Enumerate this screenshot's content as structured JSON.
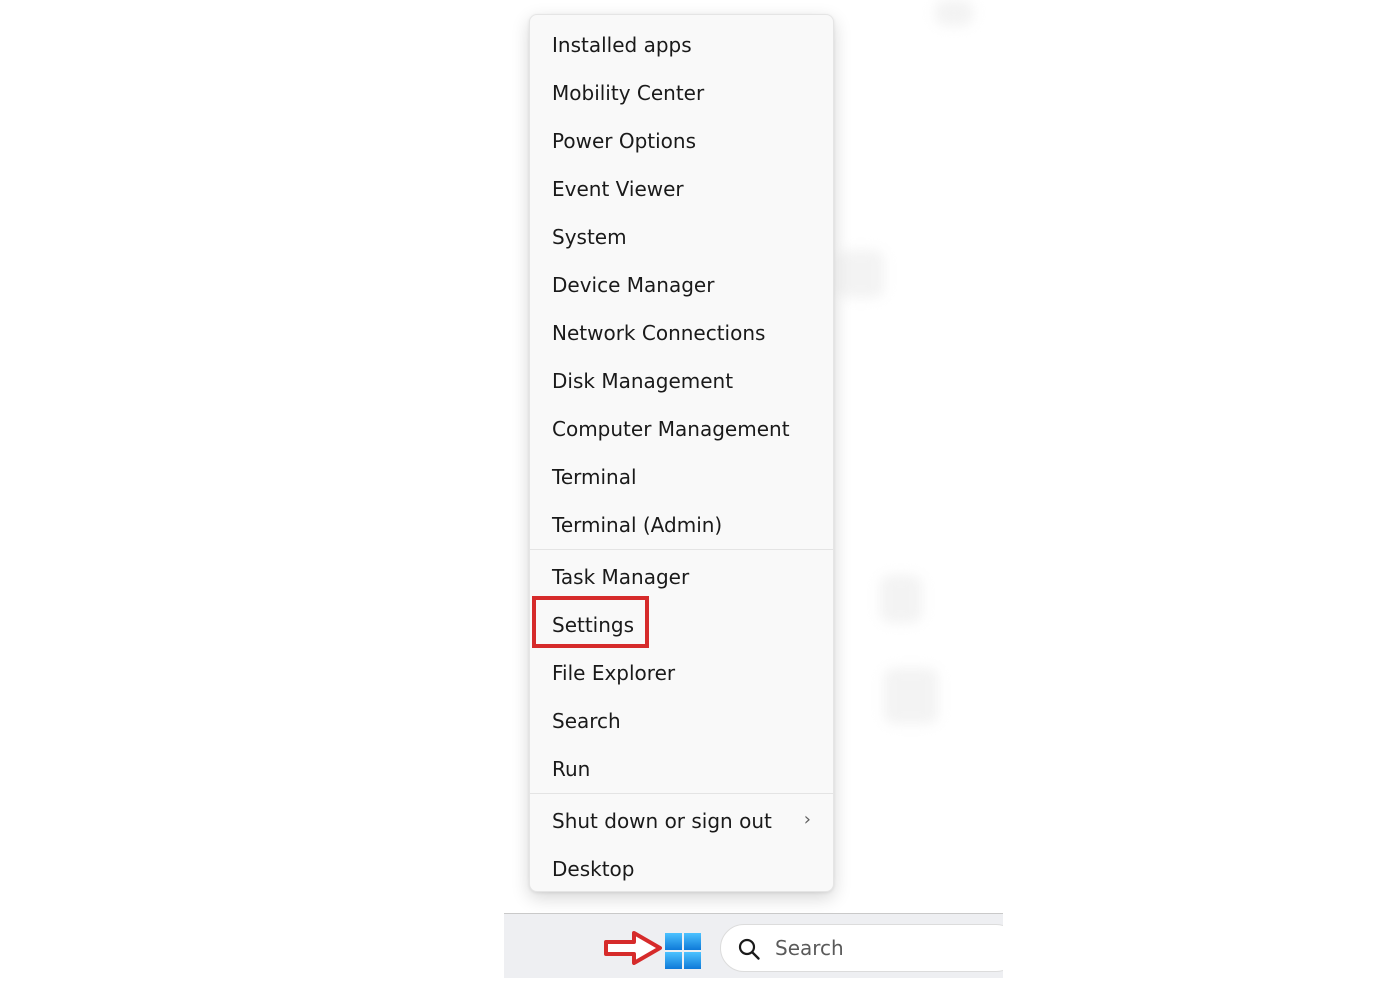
{
  "context_menu": {
    "group1": [
      {
        "label": "Installed apps"
      },
      {
        "label": "Mobility Center"
      },
      {
        "label": "Power Options"
      },
      {
        "label": "Event Viewer"
      },
      {
        "label": "System"
      },
      {
        "label": "Device Manager"
      },
      {
        "label": "Network Connections"
      },
      {
        "label": "Disk Management"
      },
      {
        "label": "Computer Management"
      },
      {
        "label": "Terminal"
      },
      {
        "label": "Terminal (Admin)"
      }
    ],
    "group2": [
      {
        "label": "Task Manager"
      },
      {
        "label": "Settings"
      },
      {
        "label": "File Explorer"
      },
      {
        "label": "Search"
      },
      {
        "label": "Run"
      }
    ],
    "group3": [
      {
        "label": "Shut down or sign out",
        "submenu_indicator": "›"
      },
      {
        "label": "Desktop"
      }
    ]
  },
  "annotation": {
    "highlight_color": "#d62b2b",
    "highlighted_item": "Settings",
    "arrow_target": "start-button"
  },
  "taskbar": {
    "start_icon": "windows-logo-icon",
    "search_icon": "search-icon",
    "search": {
      "placeholder": "Search"
    }
  },
  "colors": {
    "menu_background": "#f9f9f9",
    "taskbar_background": "#eeeff2",
    "windows_blue": "#1a8ae6"
  }
}
